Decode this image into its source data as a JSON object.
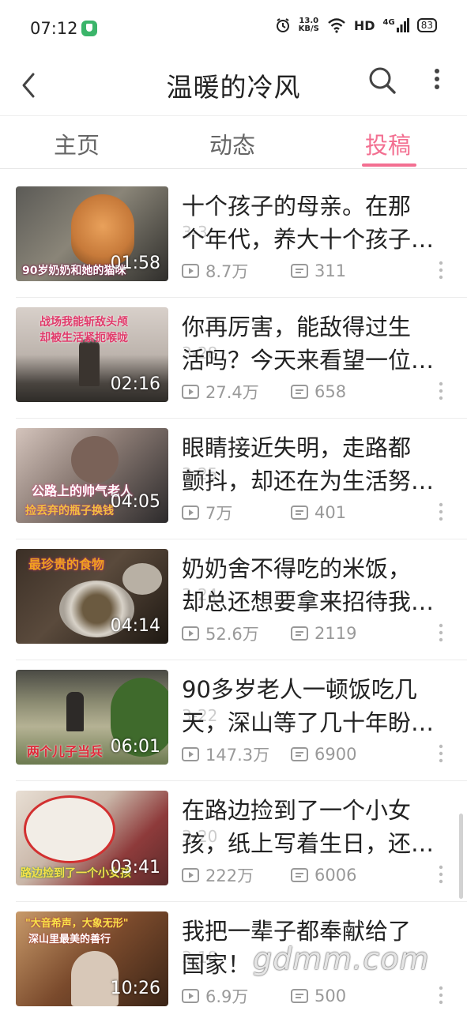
{
  "status": {
    "time": "07:12",
    "net_speed_top": "13.0",
    "net_speed_unit": "KB/S",
    "hd": "HD",
    "net_type": "4G",
    "battery": "83"
  },
  "header": {
    "title": "温暖的冷风"
  },
  "tabs": [
    {
      "label": "主页"
    },
    {
      "label": "动态"
    },
    {
      "label": "投稿"
    }
  ],
  "videos": [
    {
      "title_l1": "十个孩子的母亲。在那",
      "title_l2": "个年代，养大十个孩子…",
      "date_ghost": "3-3",
      "duration": "01:58",
      "views": "8.7万",
      "comments": "311",
      "thumb_caption": "90岁奶奶和她的猫咪",
      "thumb_colors": [
        "#5b5a56",
        "#8a8578",
        "#2f2e2b"
      ]
    },
    {
      "title_l1": "你再厉害，能敌得过生",
      "title_l2": "活吗？今天来看望一位…",
      "date_ghost": "3-28",
      "duration": "02:16",
      "views": "27.4万",
      "comments": "658",
      "thumb_caption": "战场我能斩敌头颅",
      "thumb_caption2": "却被生活紧扼喉咙",
      "thumb_colors": [
        "#cfc6c0",
        "#9b948c",
        "#3d3a36"
      ]
    },
    {
      "title_l1": "眼睛接近失明，走路都",
      "title_l2": "颤抖，却还在为生活努…",
      "date_ghost": "3-25",
      "duration": "04:05",
      "views": "7万",
      "comments": "401",
      "thumb_caption": "公路上的帅气老人",
      "thumb_caption2": "捡丢弃的瓶子换钱",
      "thumb_colors": [
        "#c7b7b0",
        "#6f6360",
        "#2c2a2b"
      ]
    },
    {
      "title_l1": "奶奶舍不得吃的米饭，",
      "title_l2": "却总还想要拿来招待我…",
      "date_ghost": "3-24",
      "duration": "04:14",
      "views": "52.6万",
      "comments": "2119",
      "thumb_caption": "最珍贵的食物",
      "thumb_colors": [
        "#3b2f26",
        "#7c6a58",
        "#1e1812"
      ]
    },
    {
      "title_l1": "90多岁老人一顿饭吃几",
      "title_l2": "天，深山等了几十年盼…",
      "date_ghost": "3-22",
      "duration": "06:01",
      "views": "147.3万",
      "comments": "6900",
      "thumb_caption": "两个儿子当兵",
      "thumb_colors": [
        "#5d6a4b",
        "#a0a37c",
        "#2d3a22"
      ]
    },
    {
      "title_l1": "在路边捡到了一个小女",
      "title_l2": "孩，纸上写着生日，还…",
      "date_ghost": "3-20",
      "duration": "03:41",
      "views": "222万",
      "comments": "6006",
      "thumb_caption": "路边捡到了一个小女孩",
      "thumb_colors": [
        "#c9b6a8",
        "#8e3b3b",
        "#e8dfd4"
      ]
    },
    {
      "title_l1": "我把一辈子都奉献给了",
      "title_l2": "国家！",
      "date_ghost": "3-18",
      "duration": "10:26",
      "views": "6.9万",
      "comments": "500",
      "thumb_caption": "\"大音希声，大象无形\"",
      "thumb_caption2": "深山里最美的善行",
      "thumb_colors": [
        "#7a4a2c",
        "#c89a6a",
        "#3a2416"
      ]
    }
  ],
  "watermark": "gdmm.com",
  "colors": {
    "accent": "#f36f91",
    "text_primary": "#222222",
    "text_secondary": "#999999"
  },
  "icons": {
    "back": "chevron-left-icon",
    "search": "search-icon",
    "more": "more-vertical-icon",
    "play": "play-icon",
    "comment": "comment-icon"
  }
}
